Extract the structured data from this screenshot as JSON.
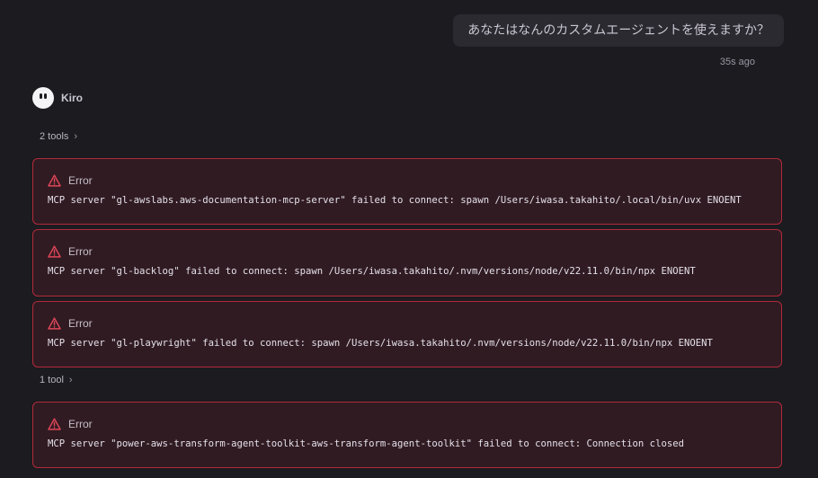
{
  "user_message": {
    "text": "あなたはなんのカスタムエージェントを使えますか？",
    "timestamp": "35s ago"
  },
  "agent": {
    "name": "Kiro",
    "avatar_icon": "kiro-ghost-icon"
  },
  "tool_groups": [
    {
      "label": "2 tools",
      "icon": "chevron-right-icon"
    },
    {
      "label": "1 tool",
      "icon": "chevron-right-icon"
    }
  ],
  "errors": [
    {
      "title": "Error",
      "icon": "warning-triangle-icon",
      "message": "MCP server \"gl-awslabs.aws-documentation-mcp-server\" failed to connect: spawn /Users/iwasa.takahito/.local/bin/uvx ENOENT"
    },
    {
      "title": "Error",
      "icon": "warning-triangle-icon",
      "message": "MCP server \"gl-backlog\" failed to connect: spawn /Users/iwasa.takahito/.nvm/versions/node/v22.11.0/bin/npx ENOENT"
    },
    {
      "title": "Error",
      "icon": "warning-triangle-icon",
      "message": "MCP server \"gl-playwright\" failed to connect: spawn /Users/iwasa.takahito/.nvm/versions/node/v22.11.0/bin/npx ENOENT"
    },
    {
      "title": "Error",
      "icon": "warning-triangle-icon",
      "message": "MCP server \"power-aws-transform-agent-toolkit-aws-transform-agent-toolkit\" failed to connect: Connection closed"
    }
  ],
  "colors": {
    "background": "#1c1b20",
    "error_border": "#b02a3b",
    "error_background": "#311b22",
    "warning_icon": "#e0465a"
  }
}
